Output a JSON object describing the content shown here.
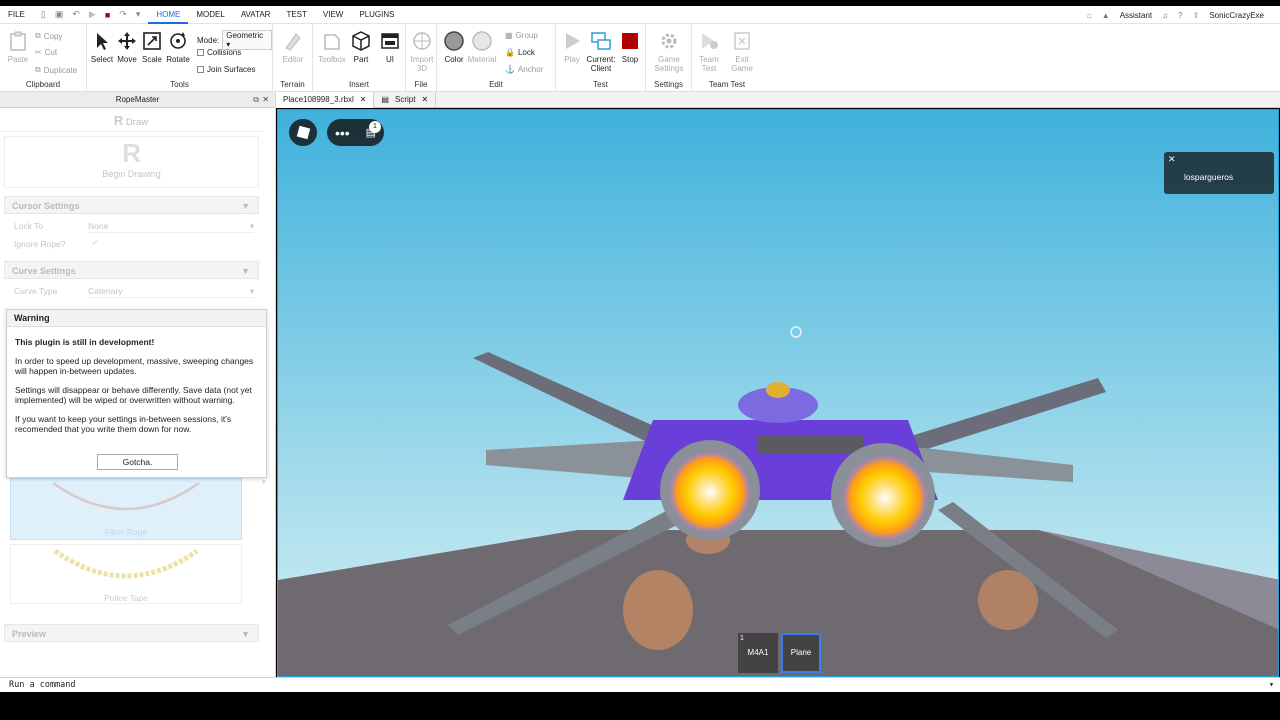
{
  "menu": {
    "file": "FILE",
    "tabs": [
      "HOME",
      "MODEL",
      "AVATAR",
      "TEST",
      "VIEW",
      "PLUGINS"
    ]
  },
  "topright": {
    "assistant": "Assistant",
    "user": "SonicCrazyExe"
  },
  "ribbon": {
    "clipboard": {
      "paste": "Paste",
      "copy": "Copy",
      "cut": "Cut",
      "duplicate": "Duplicate",
      "label": "Clipboard"
    },
    "tools": {
      "select": "Select",
      "move": "Move",
      "scale": "Scale",
      "rotate": "Rotate",
      "mode_label": "Mode:",
      "mode_value": "Geometric",
      "collisions": "Collisions",
      "join_surfaces": "Join Surfaces",
      "label": "Tools"
    },
    "terrain": {
      "editor": "Editor",
      "label": "Terrain"
    },
    "insert": {
      "toolbox": "Toolbox",
      "part": "Part",
      "ui": "UI",
      "label": "Insert"
    },
    "file": {
      "import": "Import 3D",
      "label": "File"
    },
    "edit": {
      "color": "Color",
      "material": "Material",
      "group": "Group",
      "lock": "Lock",
      "anchor": "Anchor",
      "label": "Edit"
    },
    "test": {
      "play": "Play",
      "current": "Current: Client",
      "stop": "Stop",
      "label": "Test"
    },
    "settings": {
      "game_settings": "Game Settings",
      "label": "Settings"
    },
    "team_test": {
      "team_test": "Team Test",
      "exit_game": "Exit Game",
      "label": "Team Test"
    }
  },
  "doc_tabs": [
    "Place108998_3.rbxl",
    "Script"
  ],
  "panel": {
    "title": "RopeMaster",
    "draw": "Draw",
    "begin_drawing": "Begin Drawing",
    "cursor_settings": "Cursor Settings",
    "lock_to_label": "Lock To",
    "lock_to_value": "None",
    "ignore_rope_label": "Ignore Rope?",
    "curve_settings": "Curve Settings",
    "curve_type_label": "Curve Type",
    "curve_type_value": "Catenary",
    "rope_1": "Fiber Rope",
    "rope_2": "Police Tape",
    "preview": "Preview"
  },
  "warning": {
    "title": "Warning",
    "heading": "This plugin is still in development!",
    "p1": "In order to speed up development, massive, sweeping changes will happen in-between updates.",
    "p2": "Settings will disappear or behave differently. Save data (not yet implemented) will be wiped or overwritten without warning.",
    "p3": "If you want to keep your settings in-between sessions, it's recomended that you write them down for now.",
    "button": "Gotcha."
  },
  "viewport": {
    "chat_badge": "1",
    "notification_user": "lospargueros",
    "hotbar": [
      {
        "number": "1",
        "name": "M4A1"
      },
      {
        "number": "",
        "name": "Plane"
      }
    ]
  },
  "command_bar": {
    "placeholder": "Run a command"
  },
  "colors": {
    "accent": "#1a6fd8",
    "stop": "#b00000",
    "sky_top": "#3fb1dc",
    "sky_bottom": "#b4e2ee",
    "plane_purple": "#6a3ed8",
    "engine_glow": "#ffcc00"
  }
}
